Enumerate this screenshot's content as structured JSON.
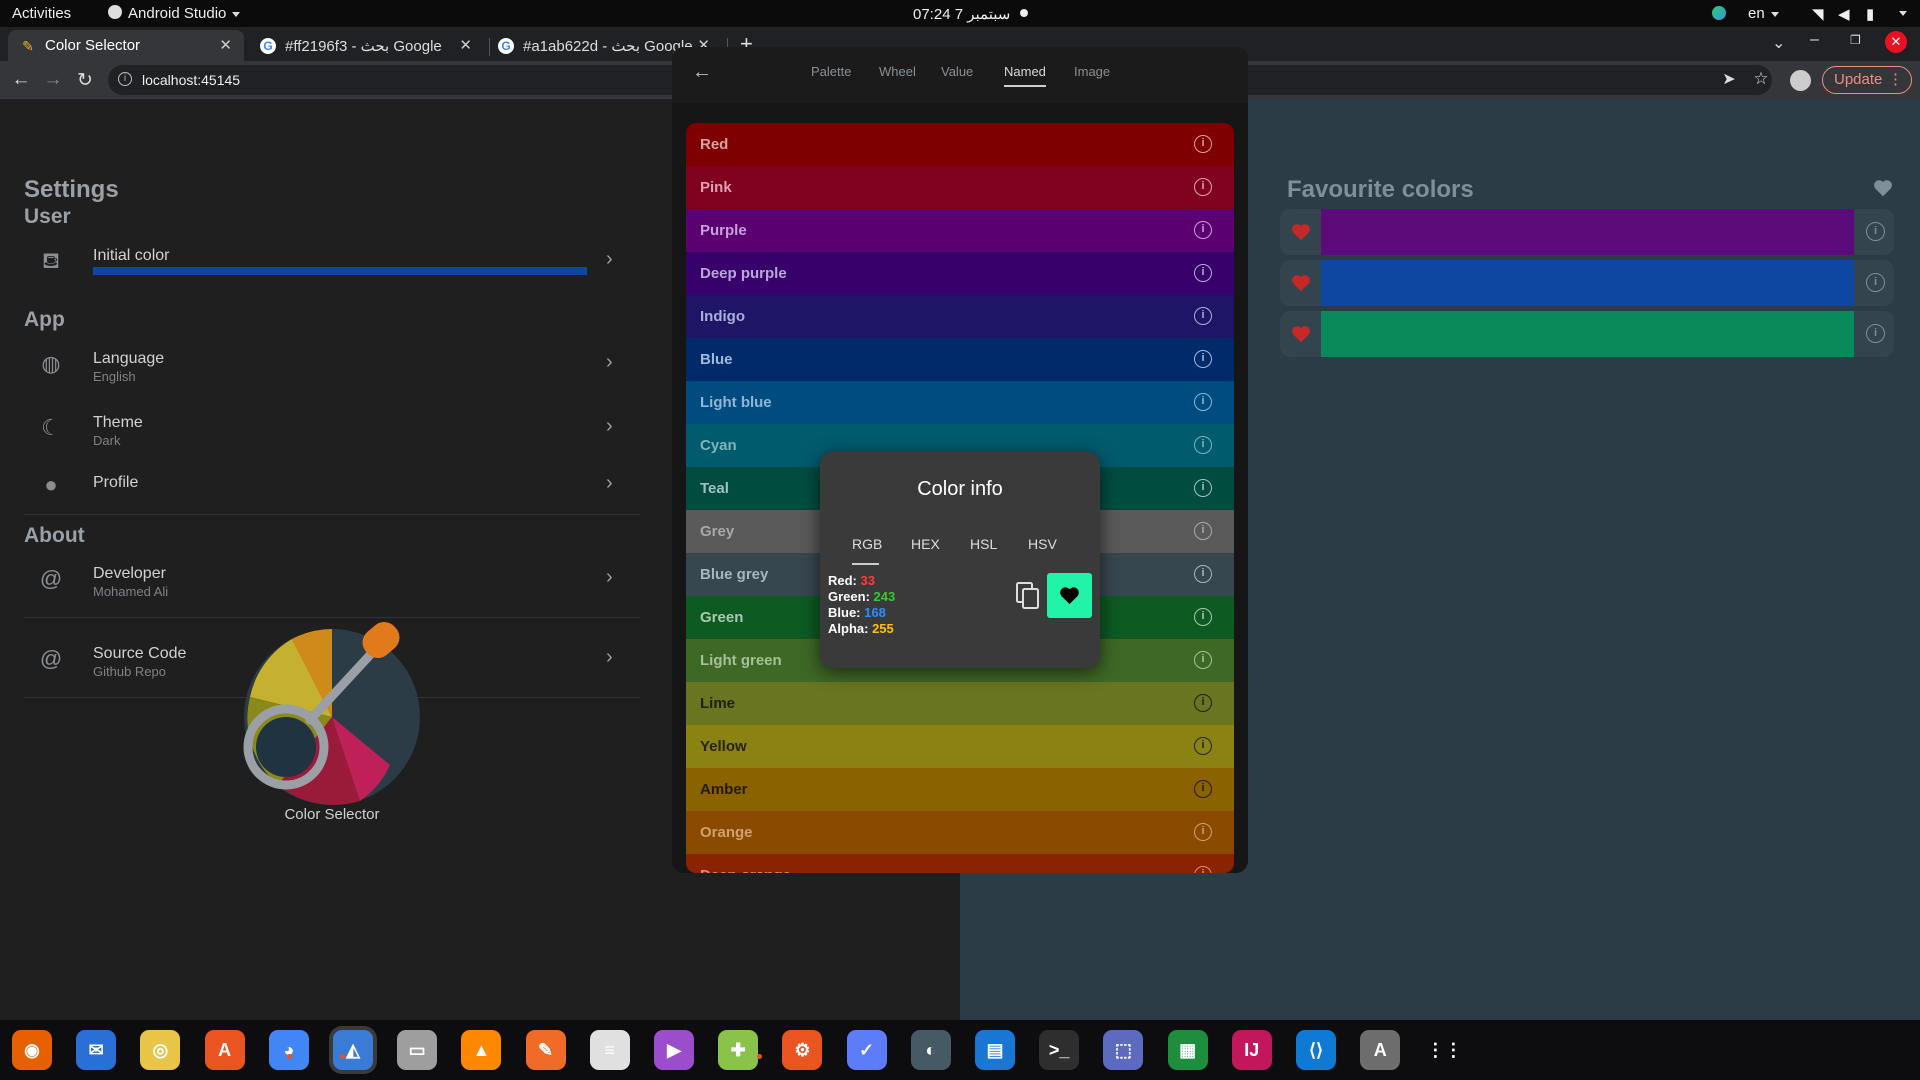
{
  "topbar": {
    "activities": "Activities",
    "app_name": "Android Studio",
    "clock": "07:24  7 سبتمبر",
    "lang": "en"
  },
  "browser": {
    "tabs": [
      {
        "title": "Color Selector",
        "icon": "color-selector-favicon"
      },
      {
        "title": "#ff2196f3 - بحث Google",
        "icon": "google-favicon"
      },
      {
        "title": "#a1ab622d - بحث Google",
        "icon": "google-favicon"
      }
    ],
    "url": "localhost:45145",
    "update_label": "Update"
  },
  "settings": {
    "title": "Settings",
    "sections": {
      "user": "User",
      "app": "App",
      "about": "About"
    },
    "items": {
      "initial_color": {
        "title": "Initial color",
        "bar_color": "#0d47a1"
      },
      "language": {
        "title": "Language",
        "subtitle": "English"
      },
      "theme": {
        "title": "Theme",
        "subtitle": "Dark"
      },
      "profile": {
        "title": "Profile"
      },
      "developer": {
        "title": "Developer",
        "subtitle": "Mohamed Ali"
      },
      "source_code": {
        "title": "Source Code",
        "subtitle": "Github Repo"
      }
    },
    "logo_label": "Color Selector"
  },
  "picker": {
    "tabs": [
      "Palette",
      "Wheel",
      "Value",
      "Named",
      "Image"
    ],
    "active_tab": "Named",
    "colors": [
      {
        "name": "Red",
        "hex": "#7f0000",
        "text": "#d8a0a0"
      },
      {
        "name": "Pink",
        "hex": "#80001f",
        "text": "#e0a0b0"
      },
      {
        "name": "Purple",
        "hex": "#5a0070",
        "text": "#c8a0d8"
      },
      {
        "name": "Deep purple",
        "hex": "#37006b",
        "text": "#b8a8d8"
      },
      {
        "name": "Indigo",
        "hex": "#1f1566",
        "text": "#a8b0d8"
      },
      {
        "name": "Blue",
        "hex": "#002a6a",
        "text": "#a0b8dc"
      },
      {
        "name": "Light blue",
        "hex": "#004b80",
        "text": "#8fb6d6"
      },
      {
        "name": "Cyan",
        "hex": "#005b6c",
        "text": "#7fb2bc"
      },
      {
        "name": "Teal",
        "hex": "#004d40",
        "text": "#9fc0bb"
      },
      {
        "name": "Grey",
        "hex": "#5a5a5a",
        "text": "#a8a8a8"
      },
      {
        "name": "Blue grey",
        "hex": "#37474f",
        "text": "#a8b6bc"
      },
      {
        "name": "Green",
        "hex": "#0d5a23",
        "text": "#a8c8b0"
      },
      {
        "name": "Light green",
        "hex": "#3e6826",
        "text": "#a8bf98"
      },
      {
        "name": "Lime",
        "hex": "#6a7520",
        "text": "#202010"
      },
      {
        "name": "Yellow",
        "hex": "#8a8313",
        "text": "#25230a"
      },
      {
        "name": "Amber",
        "hex": "#8a6200",
        "text": "#231a00"
      },
      {
        "name": "Orange",
        "hex": "#8a4a00",
        "text": "#d0a070"
      },
      {
        "name": "Deep orange",
        "hex": "#8a2400",
        "text": "#d09080"
      }
    ]
  },
  "dialog": {
    "title": "Color info",
    "tabs": [
      "RGB",
      "HEX",
      "HSL",
      "HSV"
    ],
    "values": [
      {
        "label": "Red: ",
        "value": "33",
        "color": "#ff3b3b"
      },
      {
        "label": "Green: ",
        "value": "243",
        "color": "#33cc33"
      },
      {
        "label": "Blue: ",
        "value": "168",
        "color": "#2d8cff"
      },
      {
        "label": "Alpha: ",
        "value": "255",
        "color": "#ffc107"
      }
    ],
    "fav_color": "#21f3a8"
  },
  "favourites": {
    "title": "Favourite colors",
    "colors": [
      "#5b0c7a",
      "#0d47a1",
      "#0a8a5a"
    ]
  },
  "dock": {
    "apps": [
      "firefox",
      "thunderbird",
      "rhythmbox",
      "software-center",
      "chrome",
      "android-studio",
      "files",
      "vlc",
      "inkscape",
      "document-viewer",
      "video-player",
      "android-sdk",
      "ubuntu-software",
      "task-manager",
      "gimp",
      "text-editor",
      "terminal",
      "screenshot",
      "spreadsheet",
      "intellij",
      "vscode",
      "software-updater",
      "show-apps"
    ]
  }
}
